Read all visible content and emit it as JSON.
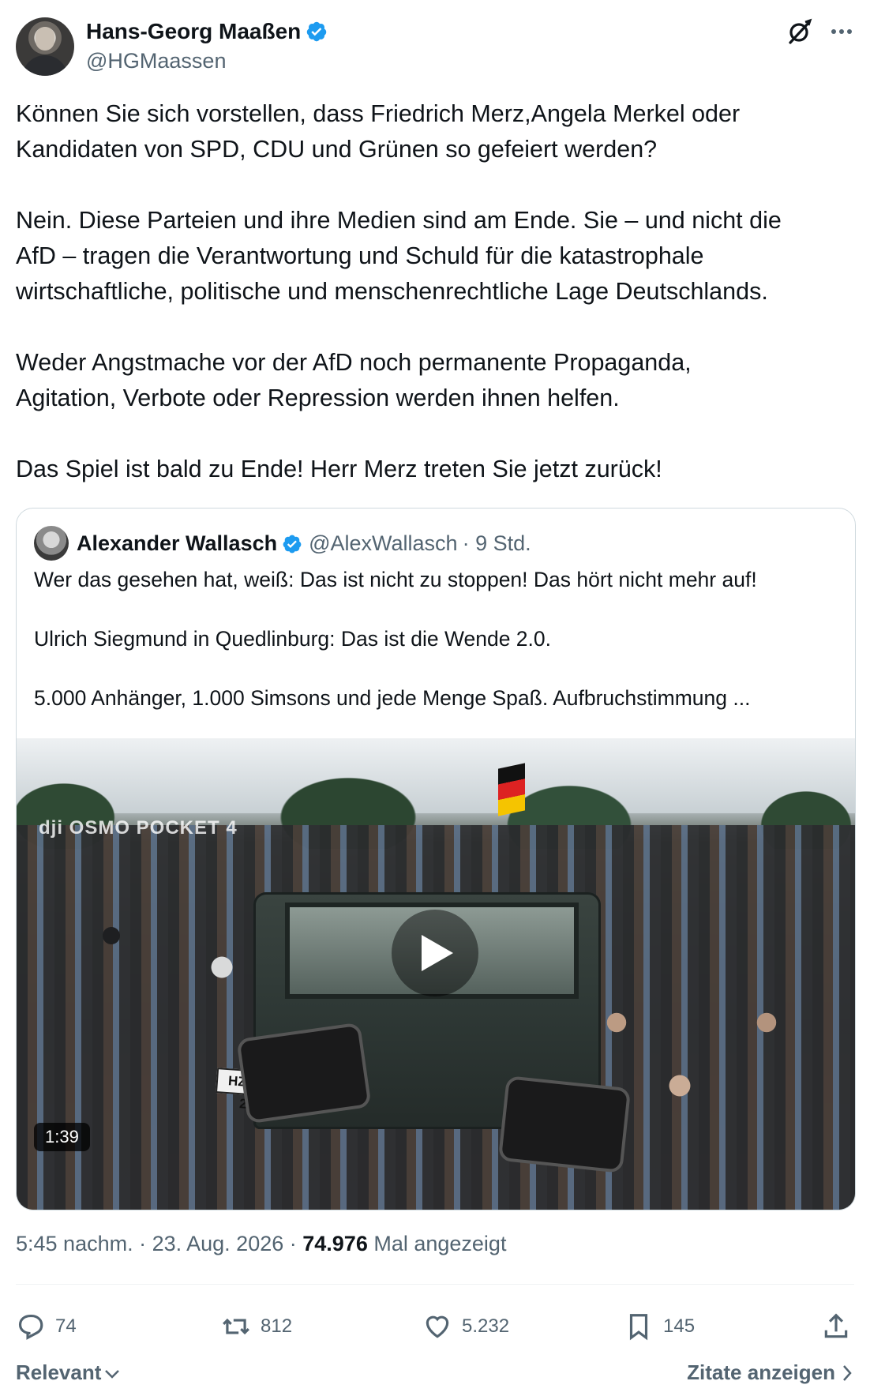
{
  "author": {
    "name": "Hans-Georg Maaßen",
    "handle": "@HGMaassen",
    "verified_color": "#1d9bf0"
  },
  "header_icons": [
    "grok-icon",
    "more-icon"
  ],
  "tweet": {
    "text": "Können Sie sich vorstellen, dass Friedrich Merz,Angela Merkel oder\nKandidaten von SPD, CDU und Grünen so gefeiert werden?\n\nNein. Diese Parteien und ihre Medien sind am Ende. Sie – und nicht die\nAfD – tragen die Verantwortung und Schuld für die katastrophale\nwirtschaftliche, politische und menschenrechtliche Lage Deutschlands.\n\nWeder Angstmache vor der AfD noch permanente Propaganda,\nAgitation, Verbote oder Repression werden ihnen helfen.\n\nDas Spiel ist bald zu Ende! Herr Merz treten Sie jetzt zurück!"
  },
  "quote": {
    "name": "Alexander Wallasch",
    "handle": "@AlexWallasch",
    "time": "· 9 Std.",
    "text": "Wer das gesehen hat, weiß: Das ist nicht zu stoppen! Das hört nicht mehr auf!\n\nUlrich Siegmund in Quedlinburg: Das ist die Wende 2.0.\n\n5.000 Anhänger, 1.000 Simsons und jede Menge Spaß. Aufbruchstimmung ...",
    "video": {
      "duration": "1:39",
      "watermark": "dji OSMO POCKET 4",
      "plate": "HZ-GU 2H"
    }
  },
  "meta": {
    "time": "5:45 nachm.",
    "sep1": " · ",
    "date": "23. Aug. 2026",
    "sep2": " · ",
    "views": "74.976",
    "views_label": " Mal angezeigt"
  },
  "actions": {
    "replies": "74",
    "reposts": "812",
    "likes": "5.232",
    "bookmarks": "145"
  },
  "footer": {
    "sort_label": "Relevant",
    "quotes_label": "Zitate anzeigen"
  },
  "colors": {
    "text": "#0f1419",
    "secondary": "#536471",
    "border": "#cfd9de",
    "accent": "#1d9bf0"
  }
}
